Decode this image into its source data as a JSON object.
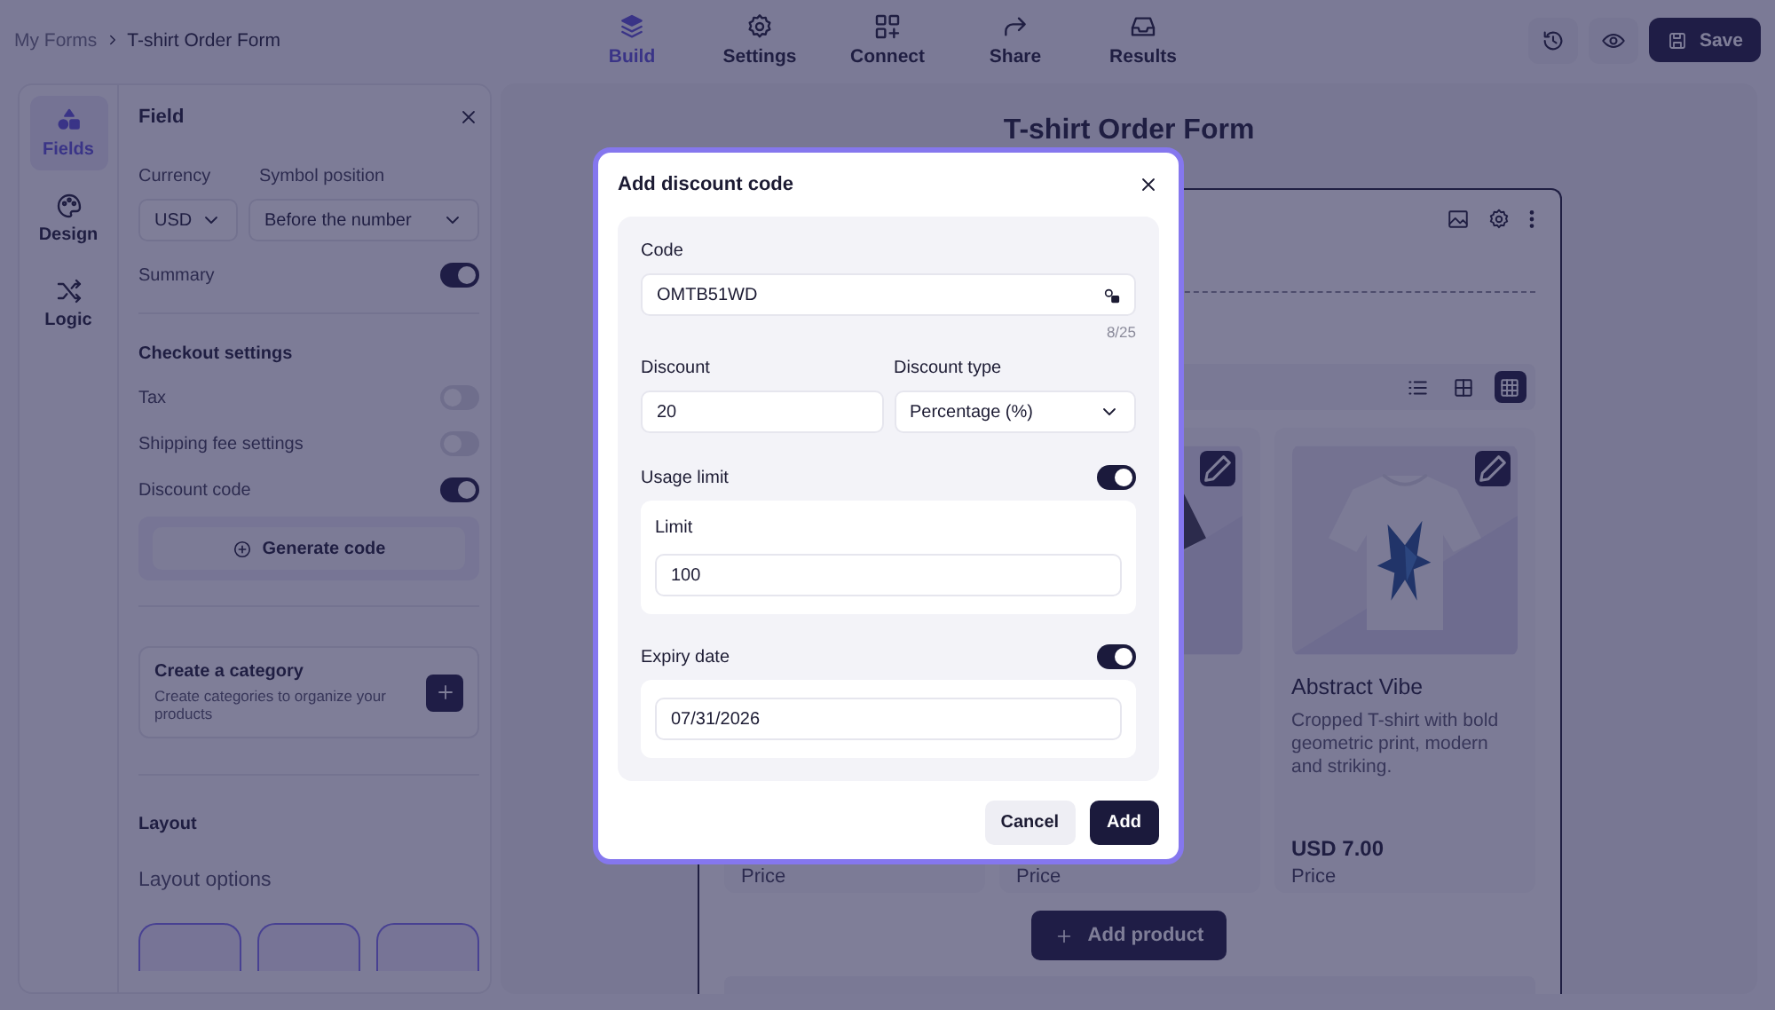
{
  "breadcrumb": {
    "parent": "My Forms",
    "current": "T-shirt Order Form"
  },
  "nav_tabs": [
    {
      "kind": "build",
      "label": "Build",
      "selected": true
    },
    {
      "kind": "settings",
      "label": "Settings",
      "selected": false
    },
    {
      "kind": "connect",
      "label": "Connect",
      "selected": false
    },
    {
      "kind": "share",
      "label": "Share",
      "selected": false
    },
    {
      "kind": "results",
      "label": "Results",
      "selected": false
    }
  ],
  "toolbar": {
    "save_label": "Save"
  },
  "side_rail": [
    {
      "kind": "fields",
      "label": "Fields",
      "selected": true
    },
    {
      "kind": "design",
      "label": "Design",
      "selected": false
    },
    {
      "kind": "logic",
      "label": "Logic",
      "selected": false
    }
  ],
  "field_panel": {
    "title": "Field",
    "currency_label": "Currency",
    "currency_value": "USD",
    "symbol_position_label": "Symbol position",
    "symbol_position_value": "Before the number",
    "summary": {
      "label": "Summary",
      "on": true
    },
    "checkout_title": "Checkout settings",
    "checkout_toggles": [
      {
        "label": "Tax",
        "on": false
      },
      {
        "label": "Shipping fee settings",
        "on": false
      },
      {
        "label": "Discount code",
        "on": true
      }
    ],
    "generate_button": "Generate code",
    "category": {
      "title": "Create a category",
      "description": "Create categories to organize your products"
    },
    "layout_title": "Layout",
    "layout_options_label": "Layout options"
  },
  "form": {
    "title": "T-shirt Order Form",
    "view_modes": [
      {
        "kind": "list",
        "selected": false
      },
      {
        "kind": "grid",
        "selected": false
      },
      {
        "kind": "compact",
        "selected": true
      }
    ],
    "products": [
      {
        "price_label": "Price"
      },
      {
        "price_label": "Price"
      },
      {
        "name": "Abstract Vibe",
        "description": "Cropped T-shirt with bold geometric print, modern and striking.",
        "price": "USD 7.00",
        "price_label": "Price"
      }
    ],
    "add_product_button": "Add product"
  },
  "modal": {
    "title": "Add discount code",
    "code_label": "Code",
    "code_value": "OMTB51WD",
    "code_counter": "8/25",
    "discount_label": "Discount",
    "discount_value": "20",
    "discount_type_label": "Discount type",
    "discount_type_value": "Percentage (%)",
    "usage_limit": {
      "label": "Usage limit",
      "on": true,
      "limit_label": "Limit",
      "limit_value": "100"
    },
    "expiry_date": {
      "label": "Expiry date",
      "on": true,
      "value": "07/31/2026"
    },
    "cancel_button": "Cancel",
    "add_button": "Add"
  }
}
